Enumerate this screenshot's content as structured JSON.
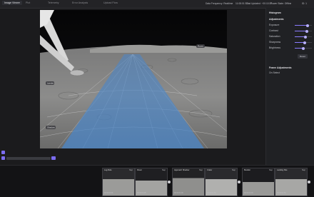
{
  "tabs": [
    "Image Viewer",
    "Plot",
    "Telemetry",
    "Error Analysis",
    "Upload Flow"
  ],
  "status": {
    "data_freq": "Data Frequency: Realtime",
    "time": "11:08:01 ET",
    "last_updated": "Last Updated: ~00:10:37",
    "power": "Power State: Offline",
    "id": "ID: 1"
  },
  "panel": {
    "histogram_label": "Histogram",
    "adjustments_label": "Adjustments",
    "sliders": [
      {
        "label": "Exposure",
        "value": 0.75
      },
      {
        "label": "Contrast",
        "value": 0.7
      },
      {
        "label": "Saturation",
        "value": 0.6
      },
      {
        "label": "Sharpness",
        "value": 0.55
      },
      {
        "label": "Brightness",
        "value": 0.45
      }
    ],
    "reset_label": "Reset",
    "preset_label": "Frame Adjustments",
    "on_label": "On Select"
  },
  "viewer_overlays": [
    "Lander",
    "Shadow",
    "Rover"
  ],
  "colors": {
    "accent": "#8a7cff",
    "cone": "#4a86c9"
  },
  "thumbnails": [
    {
      "caption": "Leg Rule",
      "timecode": "00:02:00.01",
      "selected": "Step"
    },
    {
      "caption": "Rover",
      "timecode": "00:02:00.25",
      "selected": "Step"
    },
    {
      "caption": "Approach Shadow",
      "timecode": "00:02:01.00",
      "selected": "Step"
    },
    {
      "caption": "Crater",
      "timecode": "00:02:01.50",
      "selected": "Step"
    },
    {
      "caption": "Boulder",
      "timecode": "00:02:02.00",
      "selected": "Step"
    },
    {
      "caption": "Landing Site",
      "timecode": "00:02:02.50",
      "selected": "Step"
    }
  ]
}
